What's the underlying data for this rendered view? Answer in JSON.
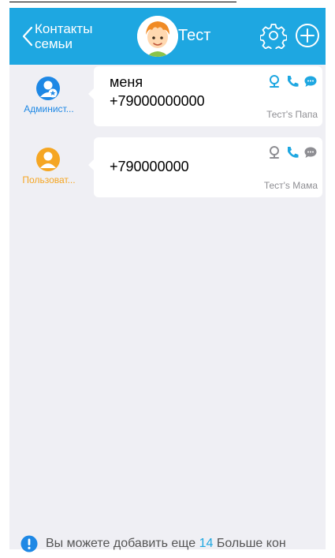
{
  "header": {
    "back_label": "Контакты семьи",
    "title": "Тест",
    "settings_icon": "gear-icon",
    "add_icon": "plus-circle-icon",
    "bar_color": "#1ea7e1"
  },
  "contacts": [
    {
      "role": "Админист...",
      "role_color": "#1e88e5",
      "role_icon": "admin-user-star-icon",
      "name": "меня",
      "phone": "+79000000000",
      "relation": "Тест's Папа",
      "location_icon_color": "#1ea7e1",
      "call_icon_color": "#1ea7e1",
      "chat_icon_color": "#1ea7e1"
    },
    {
      "role": "Пользоват...",
      "role_color": "#f5a623",
      "role_icon": "user-icon",
      "name": "",
      "phone": "+790000000",
      "relation": "Тест's Мама",
      "location_icon_color": "#8e8e93",
      "call_icon_color": "#1ea7e1",
      "chat_icon_color": "#8e8e93"
    }
  ],
  "footer": {
    "icon": "info-icon",
    "text_before": "Вы можете добавить еще",
    "count": "14",
    "text_after": "Больше кон"
  }
}
